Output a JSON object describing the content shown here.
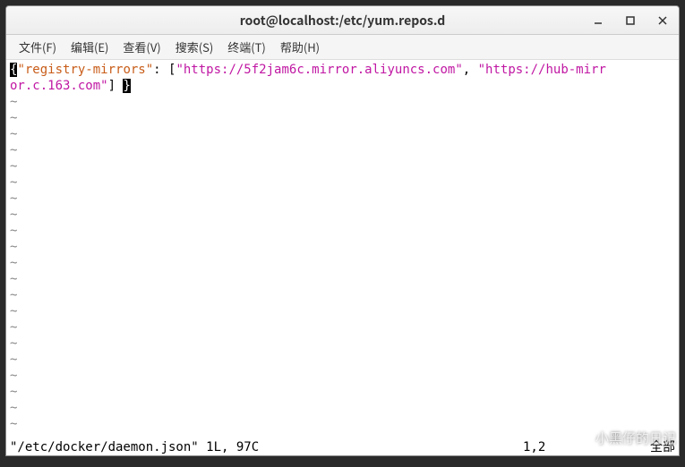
{
  "window": {
    "title": "root@localhost:/etc/yum.repos.d"
  },
  "menubar": {
    "items": [
      {
        "label": "文件(F)"
      },
      {
        "label": "编辑(E)"
      },
      {
        "label": "查看(V)"
      },
      {
        "label": "搜索(S)"
      },
      {
        "label": "终端(T)"
      },
      {
        "label": "帮助(H)"
      }
    ]
  },
  "editor": {
    "json_key": "\"registry-mirrors\"",
    "url1": "\"https://5f2jam6c.mirror.aliyuncs.com\"",
    "url2_part1": "\"https://hub-mirr",
    "url2_part2": "or.c.163.com\"",
    "status_file": "\"/etc/docker/daemon.json\" 1L, 97C",
    "status_pos": "1,2",
    "status_scroll": "全部"
  },
  "watermark": {
    "text": "小黑仔的日记"
  }
}
